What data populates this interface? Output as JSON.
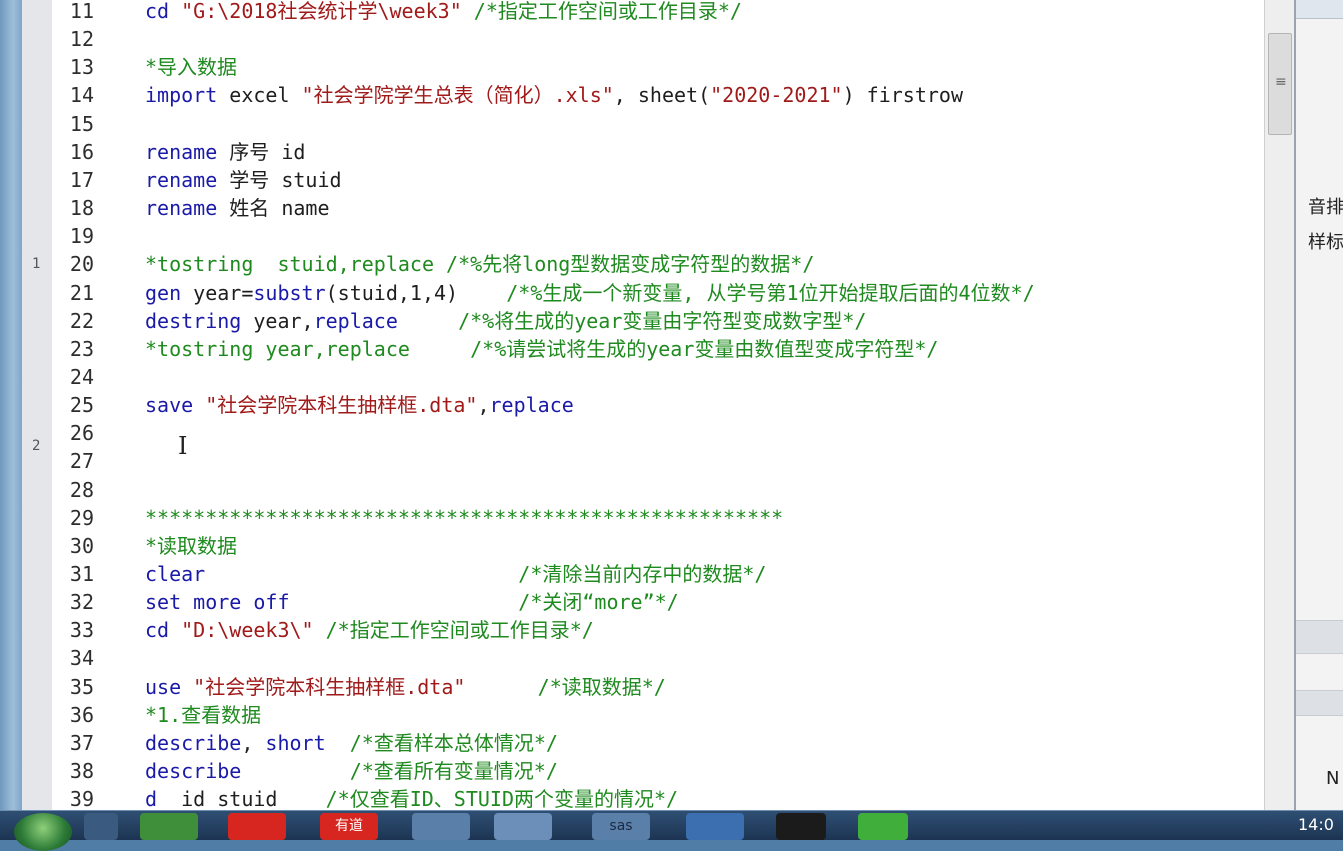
{
  "editor": {
    "lines": [
      {
        "n": "11",
        "tokens": [
          {
            "c": "k",
            "v": "cd "
          },
          {
            "c": "s",
            "v": "\"G:\\2018社会统计学\\week3\""
          },
          {
            "c": "t",
            "v": " "
          },
          {
            "c": "c",
            "v": "/*指定工作空间或工作目录*/"
          }
        ]
      },
      {
        "n": "12",
        "tokens": []
      },
      {
        "n": "13",
        "tokens": [
          {
            "c": "c",
            "v": "*导入数据"
          }
        ]
      },
      {
        "n": "14",
        "tokens": [
          {
            "c": "k",
            "v": "import"
          },
          {
            "c": "t",
            "v": " excel "
          },
          {
            "c": "s",
            "v": "\"社会学院学生总表（简化）.xls\""
          },
          {
            "c": "t",
            "v": ", sheet("
          },
          {
            "c": "s",
            "v": "\"2020-2021\""
          },
          {
            "c": "t",
            "v": ") firstrow"
          }
        ]
      },
      {
        "n": "15",
        "tokens": []
      },
      {
        "n": "16",
        "tokens": [
          {
            "c": "k",
            "v": "rename"
          },
          {
            "c": "t",
            "v": " 序号 id"
          }
        ]
      },
      {
        "n": "17",
        "tokens": [
          {
            "c": "k",
            "v": "rename"
          },
          {
            "c": "t",
            "v": " 学号 stuid"
          }
        ]
      },
      {
        "n": "18",
        "tokens": [
          {
            "c": "k",
            "v": "rename"
          },
          {
            "c": "t",
            "v": " 姓名 name"
          }
        ]
      },
      {
        "n": "19",
        "tokens": []
      },
      {
        "n": "20",
        "tokens": [
          {
            "c": "c",
            "v": "*tostring  stuid,replace /*%先将long型数据变成字符型的数据*/"
          }
        ]
      },
      {
        "n": "21",
        "tokens": [
          {
            "c": "k",
            "v": "gen"
          },
          {
            "c": "t",
            "v": " year="
          },
          {
            "c": "k",
            "v": "substr"
          },
          {
            "c": "t",
            "v": "(stuid,1,4)    "
          },
          {
            "c": "c",
            "v": "/*%生成一个新变量, 从学号第1位开始提取后面的4位数*/"
          }
        ]
      },
      {
        "n": "22",
        "tokens": [
          {
            "c": "k",
            "v": "destring"
          },
          {
            "c": "t",
            "v": " year,"
          },
          {
            "c": "k",
            "v": "replace"
          },
          {
            "c": "t",
            "v": "     "
          },
          {
            "c": "c",
            "v": "/*%将生成的year变量由字符型变成数字型*/"
          }
        ]
      },
      {
        "n": "23",
        "tokens": [
          {
            "c": "c",
            "v": "*tostring year,replace     /*%请尝试将生成的year变量由数值型变成字符型*/"
          }
        ]
      },
      {
        "n": "24",
        "tokens": []
      },
      {
        "n": "25",
        "tokens": [
          {
            "c": "k",
            "v": "save"
          },
          {
            "c": "t",
            "v": " "
          },
          {
            "c": "s",
            "v": "\"社会学院本科生抽样框.dta\""
          },
          {
            "c": "t",
            "v": ","
          },
          {
            "c": "k",
            "v": "replace"
          }
        ]
      },
      {
        "n": "26",
        "tokens": []
      },
      {
        "n": "27",
        "tokens": []
      },
      {
        "n": "28",
        "tokens": []
      },
      {
        "n": "29",
        "tokens": [
          {
            "c": "c",
            "v": "*****************************************************"
          }
        ]
      },
      {
        "n": "30",
        "tokens": [
          {
            "c": "c",
            "v": "*读取数据"
          }
        ]
      },
      {
        "n": "31",
        "tokens": [
          {
            "c": "k",
            "v": "clear"
          },
          {
            "c": "t",
            "v": "                          "
          },
          {
            "c": "c",
            "v": "/*清除当前内存中的数据*/"
          }
        ]
      },
      {
        "n": "32",
        "tokens": [
          {
            "c": "k",
            "v": "set more off"
          },
          {
            "c": "t",
            "v": "                   "
          },
          {
            "c": "c",
            "v": "/*关闭“more”*/"
          }
        ]
      },
      {
        "n": "33",
        "tokens": [
          {
            "c": "k",
            "v": "cd "
          },
          {
            "c": "s",
            "v": "\"D:\\week3\\\""
          },
          {
            "c": "t",
            "v": " "
          },
          {
            "c": "c",
            "v": "/*指定工作空间或工作目录*/"
          }
        ]
      },
      {
        "n": "34",
        "tokens": []
      },
      {
        "n": "35",
        "tokens": [
          {
            "c": "k",
            "v": "use"
          },
          {
            "c": "t",
            "v": " "
          },
          {
            "c": "s",
            "v": "\"社会学院本科生抽样框.dta\""
          },
          {
            "c": "t",
            "v": "      "
          },
          {
            "c": "c",
            "v": "/*读取数据*/"
          }
        ]
      },
      {
        "n": "36",
        "tokens": [
          {
            "c": "c",
            "v": "*1.查看数据"
          }
        ]
      },
      {
        "n": "37",
        "tokens": [
          {
            "c": "k",
            "v": "describe"
          },
          {
            "c": "t",
            "v": ", "
          },
          {
            "c": "k",
            "v": "short"
          },
          {
            "c": "t",
            "v": "  "
          },
          {
            "c": "c",
            "v": "/*查看样本总体情况*/"
          }
        ]
      },
      {
        "n": "38",
        "tokens": [
          {
            "c": "k",
            "v": "describe"
          },
          {
            "c": "t",
            "v": "         "
          },
          {
            "c": "c",
            "v": "/*查看所有变量情况*/"
          }
        ]
      },
      {
        "n": "39",
        "tokens": [
          {
            "c": "k",
            "v": "d"
          },
          {
            "c": "t",
            "v": "  id stuid    "
          },
          {
            "c": "c",
            "v": "/*仅查看ID、STUID两个变量的情况*/"
          }
        ]
      }
    ]
  },
  "margin": {
    "marks": [
      "1",
      "2"
    ]
  },
  "side_panel": {
    "text1": "音排",
    "text2": "样标",
    "text3": "N"
  },
  "taskbar": {
    "items": [
      "",
      "",
      "",
      "有道",
      "",
      "",
      "sas",
      "",
      "",
      ""
    ],
    "clock": "14:0"
  },
  "scrollbar": {
    "grip_icon": "grip-lines-icon"
  }
}
